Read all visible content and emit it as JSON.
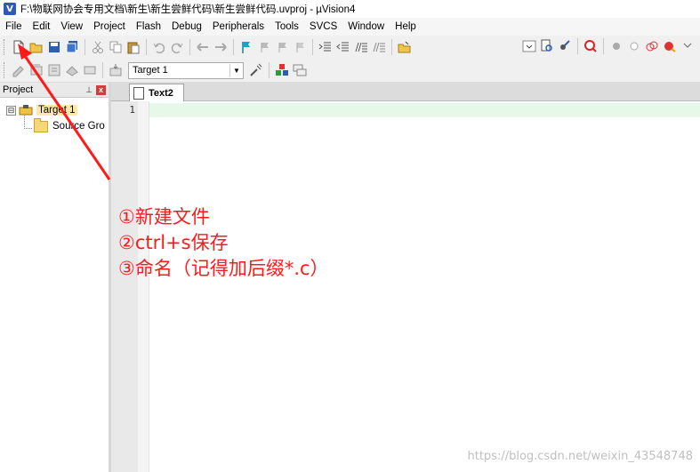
{
  "window": {
    "title": "F:\\物联网协会专用文档\\新生\\新生尝鲜代码\\新生尝鲜代码.uvproj - µVision4",
    "app_icon_letter": "V"
  },
  "menu": [
    "File",
    "Edit",
    "View",
    "Project",
    "Flash",
    "Debug",
    "Peripherals",
    "Tools",
    "SVCS",
    "Window",
    "Help"
  ],
  "toolbar2": {
    "target_select_value": "Target 1"
  },
  "project_panel": {
    "title": "Project",
    "pin": "⊥",
    "close": "x",
    "tree": [
      {
        "label": "Target 1",
        "expander": "⊟"
      },
      {
        "label": "Source Gro"
      }
    ]
  },
  "editor": {
    "tab_label": "Text2",
    "line_number": "1"
  },
  "annotations": [
    "①新建文件",
    "②ctrl+s保存",
    "③命名（记得加后缀*.c）"
  ],
  "watermark": "https://blog.csdn.net/weixin_43548748",
  "colors": {
    "annotation": "#ff1a1a",
    "current_line": "#e6f8e8"
  }
}
